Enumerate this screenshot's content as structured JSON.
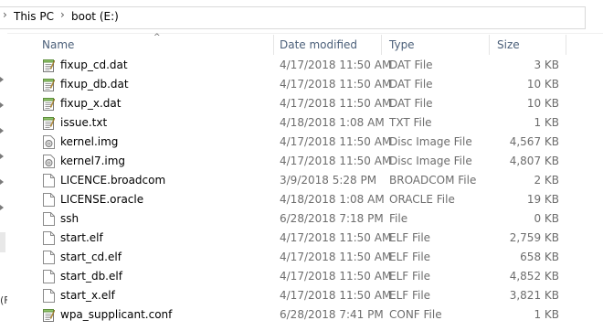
{
  "breadcrumb": {
    "items": [
      "This PC",
      "boot (E:)"
    ]
  },
  "columns": {
    "name": "Name",
    "date": "Date modified",
    "type": "Type",
    "size": "Size"
  },
  "left_pane": {
    "partial_text": "(F"
  },
  "files": [
    {
      "name": "fixup_cd.dat",
      "date": "4/17/2018 11:50 AM",
      "type": "DAT File",
      "size": "3 KB",
      "icon": "dat-file-icon"
    },
    {
      "name": "fixup_db.dat",
      "date": "4/17/2018 11:50 AM",
      "type": "DAT File",
      "size": "10 KB",
      "icon": "dat-file-icon"
    },
    {
      "name": "fixup_x.dat",
      "date": "4/17/2018 11:50 AM",
      "type": "DAT File",
      "size": "10 KB",
      "icon": "dat-file-icon"
    },
    {
      "name": "issue.txt",
      "date": "4/18/2018 1:08 AM",
      "type": "TXT File",
      "size": "1 KB",
      "icon": "text-file-icon"
    },
    {
      "name": "kernel.img",
      "date": "4/17/2018 11:50 AM",
      "type": "Disc Image File",
      "size": "4,567 KB",
      "icon": "disc-image-icon"
    },
    {
      "name": "kernel7.img",
      "date": "4/17/2018 11:50 AM",
      "type": "Disc Image File",
      "size": "4,807 KB",
      "icon": "disc-image-icon"
    },
    {
      "name": "LICENCE.broadcom",
      "date": "3/9/2018 5:28 PM",
      "type": "BROADCOM File",
      "size": "2 KB",
      "icon": "blank-file-icon"
    },
    {
      "name": "LICENSE.oracle",
      "date": "4/18/2018 1:08 AM",
      "type": "ORACLE File",
      "size": "19 KB",
      "icon": "blank-file-icon"
    },
    {
      "name": "ssh",
      "date": "6/28/2018 7:18 PM",
      "type": "File",
      "size": "0 KB",
      "icon": "blank-file-icon"
    },
    {
      "name": "start.elf",
      "date": "4/17/2018 11:50 AM",
      "type": "ELF File",
      "size": "2,759 KB",
      "icon": "blank-file-icon"
    },
    {
      "name": "start_cd.elf",
      "date": "4/17/2018 11:50 AM",
      "type": "ELF File",
      "size": "658 KB",
      "icon": "blank-file-icon"
    },
    {
      "name": "start_db.elf",
      "date": "4/17/2018 11:50 AM",
      "type": "ELF File",
      "size": "4,852 KB",
      "icon": "blank-file-icon"
    },
    {
      "name": "start_x.elf",
      "date": "4/17/2018 11:50 AM",
      "type": "ELF File",
      "size": "3,821 KB",
      "icon": "blank-file-icon"
    },
    {
      "name": "wpa_supplicant.conf",
      "date": "6/28/2018 7:41 PM",
      "type": "CONF File",
      "size": "1 KB",
      "icon": "conf-file-icon"
    }
  ],
  "colors": {
    "header_text": "#4c607a",
    "secondary_text": "#6d6d6d",
    "notepad_green": "#6aa84f"
  }
}
